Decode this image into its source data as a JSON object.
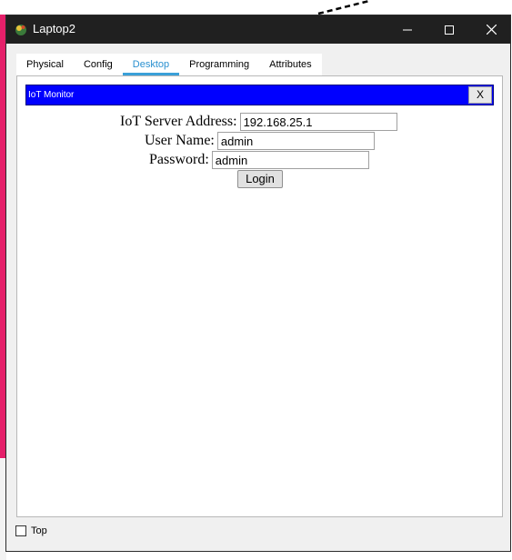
{
  "window": {
    "title": "Laptop2",
    "controls": [
      "minimize-icon",
      "maximize-icon",
      "close-icon"
    ]
  },
  "tabs": [
    {
      "label": "Physical",
      "active": false
    },
    {
      "label": "Config",
      "active": false
    },
    {
      "label": "Desktop",
      "active": true
    },
    {
      "label": "Programming",
      "active": false
    },
    {
      "label": "Attributes",
      "active": false
    }
  ],
  "iot_monitor": {
    "title": "IoT Monitor",
    "close_label": "X",
    "server_address_label": "IoT Server Address:",
    "server_address_value": "192.168.25.1",
    "username_label": "User Name:",
    "username_value": "admin",
    "password_label": "Password:",
    "password_value": "admin",
    "login_label": "Login"
  },
  "footer": {
    "top_label": "Top",
    "top_checked": false
  },
  "colors": {
    "titlebar": "#202020",
    "iot_bar": "#0000ff",
    "active_tab": "#2a90d0",
    "background_pink": "#e5206a"
  }
}
